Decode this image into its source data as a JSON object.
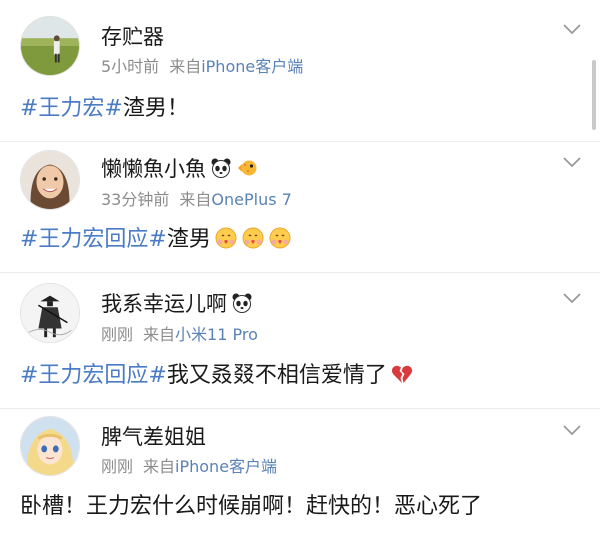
{
  "posts": [
    {
      "username": "存贮器",
      "time": "5小时前",
      "from_label": "来自",
      "source": "iPhone客户端",
      "content": {
        "tag": "#王力宏#",
        "text": "渣男！"
      }
    },
    {
      "username": "懒懒魚小魚",
      "time": "33分钟前",
      "from_label": "来自",
      "source": "OnePlus 7",
      "content": {
        "tag": "#王力宏回应#",
        "text": "渣男"
      },
      "username_icons": [
        "panda-icon",
        "pufferfish-icon"
      ],
      "content_icons": [
        "heart-hug-emoji",
        "heart-hug-emoji",
        "heart-hug-emoji"
      ]
    },
    {
      "username": "我系幸运儿啊",
      "time": "刚刚",
      "from_label": "来自",
      "source": "小米11 Pro",
      "content": {
        "tag": "#王力宏回应#",
        "text": "我又叒叕不相信爱情了"
      },
      "username_icons": [
        "panda-icon"
      ],
      "content_icons": [
        "broken-heart-icon"
      ]
    },
    {
      "username": "脾气差姐姐",
      "time": "刚刚",
      "from_label": "来自",
      "source": "iPhone客户端",
      "content": {
        "tag": "",
        "text": "卧槽！王力宏什么时候崩啊！赶快的！恶心死了"
      }
    }
  ],
  "colors": {
    "link": "#4a7bc4",
    "source": "#5b82b6",
    "meta": "#8c8c8c",
    "text": "#1a1a1a"
  }
}
